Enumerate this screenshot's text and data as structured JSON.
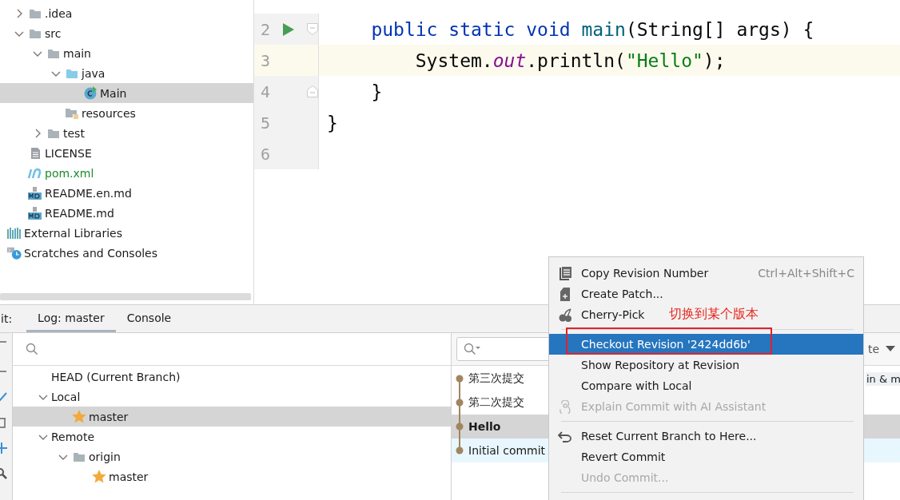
{
  "project_tree": {
    "items": [
      {
        "label": ".idea",
        "kind": "folder",
        "expanded": false,
        "selected": false
      },
      {
        "label": "src",
        "kind": "folder",
        "expanded": true,
        "selected": false,
        "children": [
          {
            "label": "main",
            "kind": "folder",
            "expanded": true,
            "selected": false,
            "children": [
              {
                "label": "java",
                "kind": "source-folder",
                "expanded": true,
                "selected": false,
                "children": [
                  {
                    "label": "Main",
                    "kind": "class",
                    "selected": true
                  }
                ]
              },
              {
                "label": "resources",
                "kind": "resources-folder",
                "selected": false
              }
            ]
          },
          {
            "label": "test",
            "kind": "folder",
            "expanded": false,
            "selected": false
          }
        ]
      },
      {
        "label": "LICENSE",
        "kind": "file",
        "selected": false
      },
      {
        "label": "pom.xml",
        "kind": "maven",
        "selected": false,
        "color": "#1e8c2d"
      },
      {
        "label": "README.en.md",
        "kind": "markdown",
        "selected": false
      },
      {
        "label": "README.md",
        "kind": "markdown",
        "selected": false
      }
    ],
    "root_items": [
      {
        "label": "External Libraries",
        "kind": "libraries",
        "selected": false
      },
      {
        "label": "Scratches and Consoles",
        "kind": "scratches",
        "selected": false
      }
    ]
  },
  "editor": {
    "lines": [
      {
        "number": "2",
        "run": true,
        "fold_start": true,
        "fold_end": false,
        "current": false,
        "tokens": [
          {
            "text": "    public",
            "kind": "keyword"
          },
          {
            "text": " static",
            "kind": "keyword"
          },
          {
            "text": " void",
            "kind": "keyword"
          },
          {
            "text": " main",
            "kind": "method"
          },
          {
            "text": "(String[] args) {",
            "kind": "plain"
          }
        ]
      },
      {
        "number": "3",
        "run": false,
        "fold_start": false,
        "fold_end": false,
        "current": true,
        "tokens": [
          {
            "text": "        System.",
            "kind": "plain"
          },
          {
            "text": "out",
            "kind": "field"
          },
          {
            "text": ".println(",
            "kind": "plain"
          },
          {
            "text": "\"Hello\"",
            "kind": "string"
          },
          {
            "text": ");",
            "kind": "plain"
          }
        ]
      },
      {
        "number": "4",
        "run": false,
        "fold_start": false,
        "fold_end": true,
        "current": false,
        "tokens": [
          {
            "text": "    }",
            "kind": "plain"
          }
        ]
      },
      {
        "number": "5",
        "run": false,
        "fold_start": false,
        "fold_end": false,
        "current": false,
        "tokens": [
          {
            "text": "}",
            "kind": "plain"
          }
        ]
      },
      {
        "number": "6",
        "run": false,
        "fold_start": false,
        "fold_end": false,
        "current": false
      }
    ]
  },
  "bottom_panel": {
    "label": "it:",
    "tabs": [
      {
        "label": "Log: master",
        "selected": true
      },
      {
        "label": "Console",
        "selected": false
      }
    ]
  },
  "branches": {
    "items": [
      {
        "label": "HEAD (Current Branch)",
        "selected": false
      },
      {
        "label": "Local",
        "expanded": true,
        "selected": false,
        "children": [
          {
            "label": "master",
            "kind": "star",
            "selected": true
          }
        ]
      },
      {
        "label": "Remote",
        "expanded": true,
        "selected": false,
        "children": [
          {
            "label": "origin",
            "kind": "folder",
            "expanded": true,
            "selected": false,
            "children": [
              {
                "label": "master",
                "kind": "star",
                "selected": false
              }
            ]
          }
        ]
      }
    ]
  },
  "log": {
    "filter": "te",
    "commits": [
      {
        "message": "第三次提交",
        "bold": false,
        "selected": false,
        "highlighted": false,
        "refs": "in & m"
      },
      {
        "message": "第二次提交",
        "bold": false,
        "selected": false,
        "highlighted": false
      },
      {
        "message": "Hello",
        "bold": true,
        "selected": true,
        "highlighted": false
      },
      {
        "message": "Initial commit",
        "bold": false,
        "selected": false,
        "highlighted": true
      }
    ]
  },
  "context_menu": {
    "items": [
      {
        "kind": "copy",
        "label": "Copy Revision Number",
        "shortcut": "Ctrl+Alt+Shift+C",
        "disabled": false,
        "selected": false
      },
      {
        "kind": "patch",
        "label": "Create Patch...",
        "disabled": false,
        "selected": false
      },
      {
        "kind": "cherry",
        "label": "Cherry-Pick",
        "disabled": false,
        "selected": false,
        "annotation": "切换到某个版本"
      },
      {
        "kind": "separator"
      },
      {
        "kind": "plain",
        "label": "Checkout Revision '2424dd6b'",
        "disabled": false,
        "selected": true,
        "boxed": true
      },
      {
        "kind": "plain",
        "label": "Show Repository at Revision",
        "disabled": false,
        "selected": false
      },
      {
        "kind": "plain",
        "label": "Compare with Local",
        "disabled": false,
        "selected": false
      },
      {
        "kind": "ai",
        "label": "Explain Commit with AI Assistant",
        "disabled": true,
        "selected": false
      },
      {
        "kind": "separator"
      },
      {
        "kind": "reset",
        "label": "Reset Current Branch to Here...",
        "disabled": false,
        "selected": false
      },
      {
        "kind": "plain",
        "label": "Revert Commit",
        "disabled": false,
        "selected": false
      },
      {
        "kind": "plain",
        "label": "Undo Commit...",
        "disabled": true,
        "selected": false
      },
      {
        "kind": "separator"
      }
    ]
  }
}
